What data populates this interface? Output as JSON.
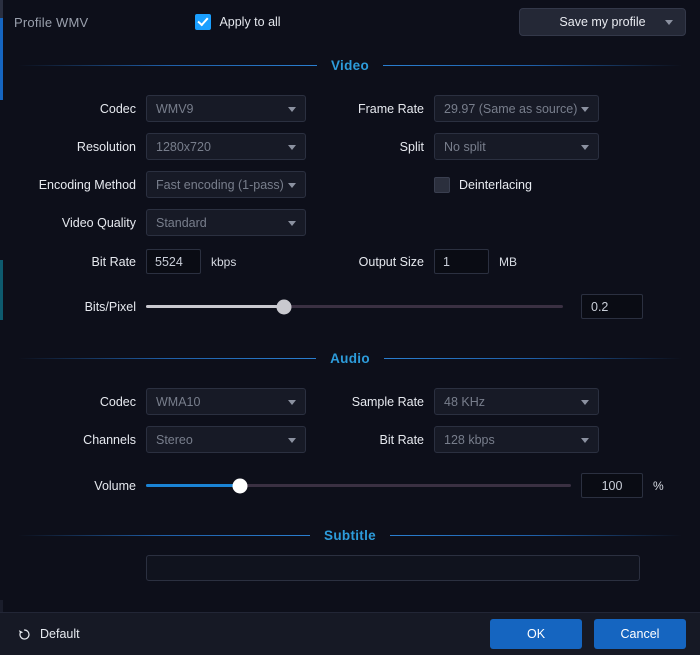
{
  "header": {
    "profile_label": "Profile  WMV",
    "apply_to_all_label": "Apply to all",
    "apply_to_all_checked": true,
    "save_profile_label": "Save my profile"
  },
  "sections": {
    "video": {
      "title": "Video",
      "codec_label": "Codec",
      "codec_value": "WMV9",
      "resolution_label": "Resolution",
      "resolution_value": "1280x720",
      "encoding_method_label": "Encoding Method",
      "encoding_method_value": "Fast encoding (1-pass)",
      "video_quality_label": "Video Quality",
      "video_quality_value": "Standard",
      "frame_rate_label": "Frame Rate",
      "frame_rate_value": "29.97 (Same as source)",
      "split_label": "Split",
      "split_value": "No split",
      "deinterlacing_label": "Deinterlacing",
      "deinterlacing_checked": false,
      "bit_rate_label": "Bit Rate",
      "bit_rate_value": "5524",
      "bit_rate_unit": "kbps",
      "output_size_label": "Output Size",
      "output_size_value": "1",
      "output_size_unit": "MB",
      "bits_pixel_label": "Bits/Pixel",
      "bits_pixel_value": "0.2",
      "bits_pixel_percent": 33
    },
    "audio": {
      "title": "Audio",
      "codec_label": "Codec",
      "codec_value": "WMA10",
      "channels_label": "Channels",
      "channels_value": "Stereo",
      "sample_rate_label": "Sample Rate",
      "sample_rate_value": "48 KHz",
      "bit_rate_label": "Bit Rate",
      "bit_rate_value": "128 kbps",
      "volume_label": "Volume",
      "volume_value": "100",
      "volume_unit": "%",
      "volume_percent": 22
    },
    "subtitle": {
      "title": "Subtitle",
      "mode_value": ""
    }
  },
  "footer": {
    "default_label": "Default",
    "ok_label": "OK",
    "cancel_label": "Cancel"
  },
  "colors": {
    "accent_blue": "#1a9fff",
    "section_title": "#2d9cdb",
    "button_blue": "#1565c0",
    "volume_fill": "#1a84d6",
    "bits_fill": "#c9c9cf",
    "background": "#0d0f1a"
  }
}
